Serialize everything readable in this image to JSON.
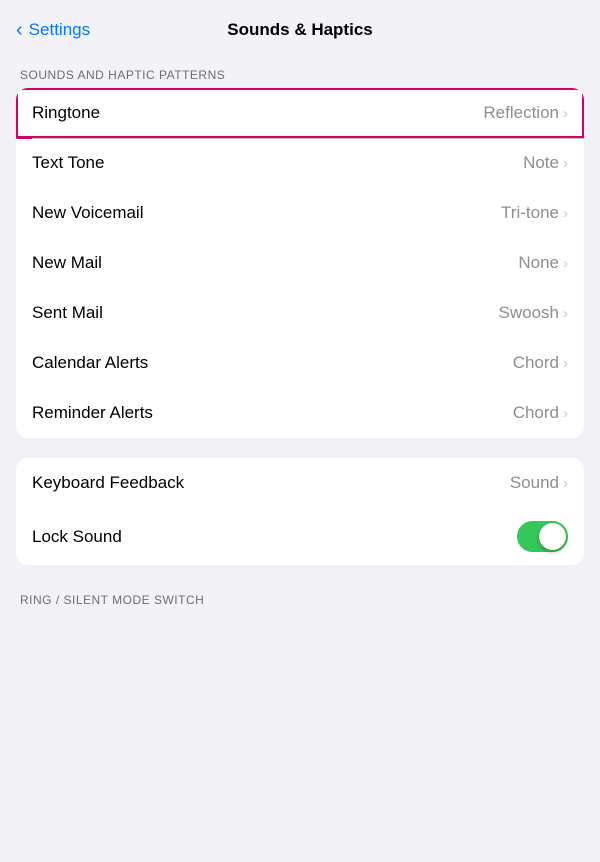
{
  "header": {
    "back_label": "Settings",
    "title": "Sounds & Haptics"
  },
  "sections": {
    "sounds_haptic_patterns": {
      "label": "SOUNDS AND HAPTIC PATTERNS",
      "items": [
        {
          "id": "ringtone",
          "label": "Ringtone",
          "value": "Reflection",
          "highlighted": true
        },
        {
          "id": "text-tone",
          "label": "Text Tone",
          "value": "Note",
          "highlighted": false
        },
        {
          "id": "new-voicemail",
          "label": "New Voicemail",
          "value": "Tri-tone",
          "highlighted": false
        },
        {
          "id": "new-mail",
          "label": "New Mail",
          "value": "None",
          "highlighted": false
        },
        {
          "id": "sent-mail",
          "label": "Sent Mail",
          "value": "Swoosh",
          "highlighted": false
        },
        {
          "id": "calendar-alerts",
          "label": "Calendar Alerts",
          "value": "Chord",
          "highlighted": false
        },
        {
          "id": "reminder-alerts",
          "label": "Reminder Alerts",
          "value": "Chord",
          "highlighted": false
        }
      ]
    },
    "feedback": {
      "items": [
        {
          "id": "keyboard-feedback",
          "label": "Keyboard Feedback",
          "value": "Sound",
          "type": "arrow"
        },
        {
          "id": "lock-sound",
          "label": "Lock Sound",
          "value": "",
          "type": "toggle",
          "toggle_on": true
        }
      ]
    },
    "ring_silent": {
      "label": "RING / SILENT MODE SWITCH"
    }
  }
}
